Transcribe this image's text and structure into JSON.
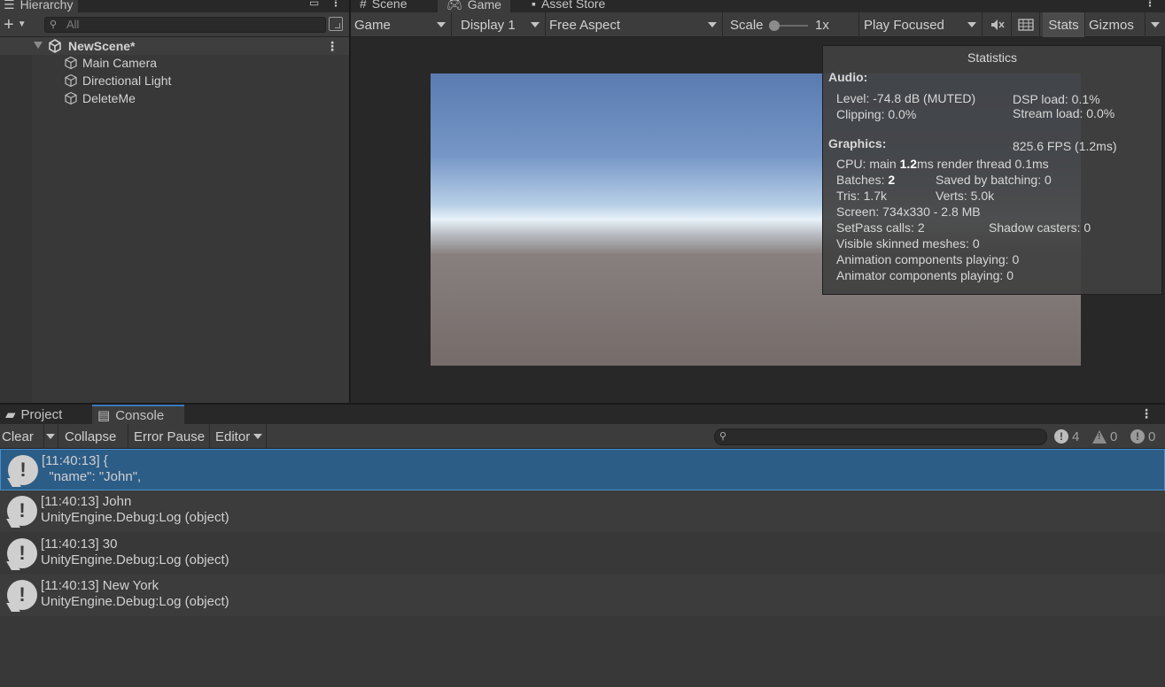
{
  "hierarchy": {
    "tab_label": "Hierarchy",
    "search_placeholder": "All",
    "scene_name": "NewScene*",
    "objects": [
      "Main Camera",
      "Directional Light",
      "DeleteMe"
    ]
  },
  "game_tabs": {
    "scene": "Scene",
    "game": "Game",
    "asset_store": "Asset Store"
  },
  "game_toolbar": {
    "view_mode": "Game",
    "display": "Display 1",
    "aspect": "Free Aspect",
    "scale_label": "Scale",
    "scale_value": "1x",
    "play_mode": "Play Focused",
    "stats": "Stats",
    "gizmos": "Gizmos"
  },
  "statistics": {
    "title": "Statistics",
    "audio_header": "Audio:",
    "level": "Level: -74.8 dB (MUTED)",
    "dsp_load": "DSP load: 0.1%",
    "clipping": "Clipping: 0.0%",
    "stream_load": "Stream load: 0.0%",
    "graphics_header": "Graphics:",
    "fps": "825.6 FPS (1.2ms)",
    "cpu_prefix": "CPU: main ",
    "cpu_main": "1.2",
    "cpu_suffix": "ms  render thread 0.1ms",
    "batches_prefix": "Batches: ",
    "batches": "2",
    "saved_batching": "Saved by batching: 0",
    "tris": "Tris: 1.7k",
    "verts": "Verts: 5.0k",
    "screen": "Screen: 734x330 - 2.8 MB",
    "setpass": "SetPass calls: 2",
    "shadow_casters": "Shadow casters: 0",
    "skinned": "Visible skinned meshes: 0",
    "animation": "Animation components playing: 0",
    "animator": "Animator components playing: 0"
  },
  "console_tabs": {
    "project": "Project",
    "console": "Console"
  },
  "console_toolbar": {
    "clear": "Clear",
    "collapse": "Collapse",
    "error_pause": "Error Pause",
    "editor": "Editor",
    "info_count": "4",
    "warning_count": "0",
    "error_count": "0"
  },
  "logs": [
    {
      "line1": "[11:40:13] {",
      "line2": "  \"name\": \"John\","
    },
    {
      "line1": "[11:40:13] John",
      "line2": "UnityEngine.Debug:Log (object)"
    },
    {
      "line1": "[11:40:13] 30",
      "line2": "UnityEngine.Debug:Log (object)"
    },
    {
      "line1": "[11:40:13] New York",
      "line2": "UnityEngine.Debug:Log (object)"
    }
  ]
}
